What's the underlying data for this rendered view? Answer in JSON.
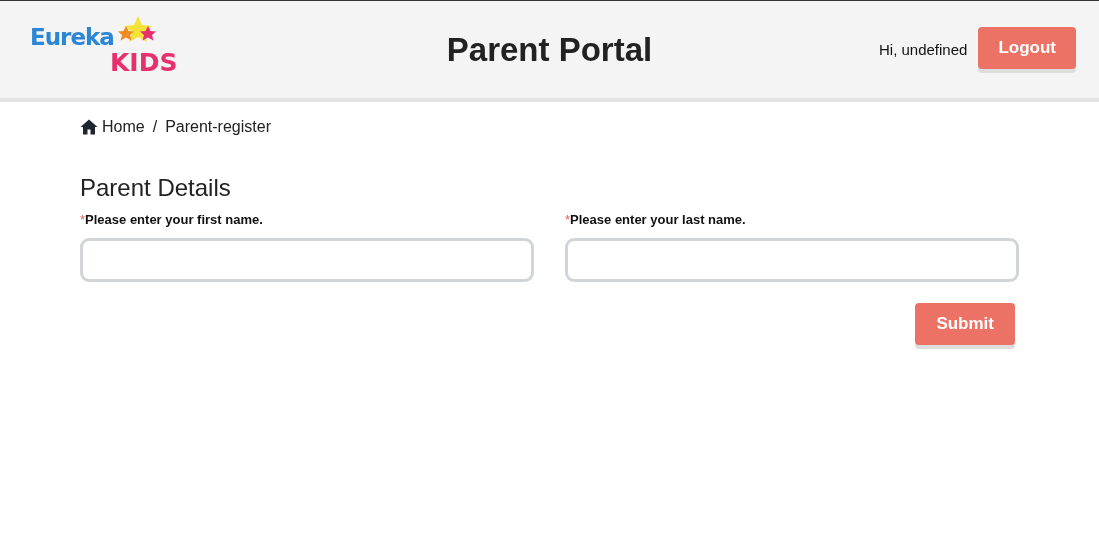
{
  "header": {
    "logo": {
      "word": "Eureka",
      "sub": "KIDS"
    },
    "title": "Parent Portal",
    "greeting": "Hi, undefined",
    "logout": "Logout"
  },
  "breadcrumb": [
    {
      "label": "Home",
      "kind": "home"
    },
    {
      "label": "Parent-register",
      "kind": "page"
    }
  ],
  "breadcrumb_separator": "/",
  "form": {
    "title": "Parent Details",
    "fields": [
      {
        "marker": "*",
        "label": "Please enter your first name."
      },
      {
        "marker": "*",
        "label": "Please enter your last name."
      }
    ],
    "submit": "Submit"
  }
}
